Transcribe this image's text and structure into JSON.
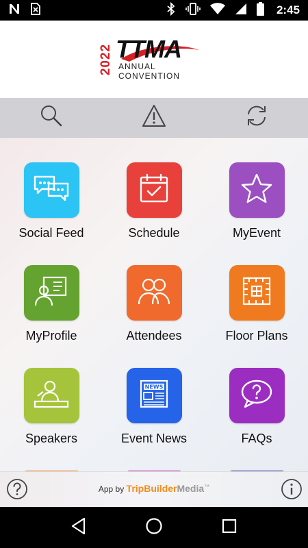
{
  "status_bar": {
    "time": "2:45",
    "icons": [
      "n-logo-icon",
      "no-sim-icon",
      "bluetooth-icon",
      "vibrate-icon",
      "wifi-icon",
      "signal-icon",
      "battery-icon"
    ]
  },
  "header": {
    "logo_year": "2022",
    "logo_main": "TTMA",
    "logo_line1": "ANNUAL",
    "logo_line2": "CONVENTION",
    "colors": {
      "red": "#d62027",
      "black": "#111111"
    }
  },
  "toolbar": {
    "buttons": [
      "search-icon",
      "alert-icon",
      "sync-icon"
    ]
  },
  "tiles": [
    {
      "label": "Social Feed",
      "icon": "chat-bubbles-icon",
      "color": "#2cc3f5"
    },
    {
      "label": "Schedule",
      "icon": "calendar-check-icon",
      "color": "#e8403a"
    },
    {
      "label": "MyEvent",
      "icon": "star-icon",
      "color": "#9b4fc1"
    },
    {
      "label": "MyProfile",
      "icon": "profile-card-icon",
      "color": "#65a330"
    },
    {
      "label": "Attendees",
      "icon": "people-icon",
      "color": "#ef6a2c"
    },
    {
      "label": "Floor Plans",
      "icon": "floor-plan-icon",
      "color": "#ef7a1f"
    },
    {
      "label": "Speakers",
      "icon": "speaker-podium-icon",
      "color": "#a5c43b"
    },
    {
      "label": "Event News",
      "icon": "newspaper-icon",
      "color": "#2563e8"
    },
    {
      "label": "FAQs",
      "icon": "question-bubble-icon",
      "color": "#9b2ec0"
    }
  ],
  "partial_row_colors": [
    "#ef7a1f",
    "#b82ab0",
    "#3b2a9c"
  ],
  "footer": {
    "prefix": "App by",
    "brand_part1": "TripBuilder",
    "brand_part2": "Media",
    "trademark": "™"
  },
  "nav": [
    "back-icon",
    "home-icon",
    "recents-icon"
  ]
}
